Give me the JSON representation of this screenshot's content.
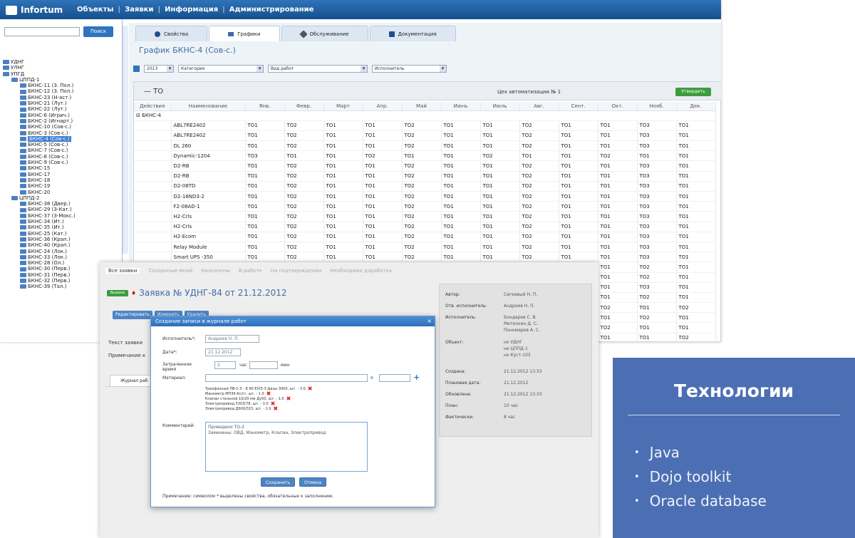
{
  "app": {
    "logo": "Infortum",
    "menu": [
      "Объекты",
      "Заявки",
      "Информация",
      "Администрирование"
    ]
  },
  "sidebar": {
    "search_button": "Поиск",
    "tree": [
      {
        "label": "УДНГ",
        "level": 0
      },
      {
        "label": "УЛНГ",
        "level": 0
      },
      {
        "label": "УПГД",
        "level": 0
      },
      {
        "label": "ЦППД-1",
        "level": 1
      },
      {
        "label": "БКНС-11 (З. Пол.)",
        "level": 2
      },
      {
        "label": "БКНС-12 (З. Пол.)",
        "level": 2
      },
      {
        "label": "БКНС-23 (Н-аст.)",
        "level": 2
      },
      {
        "label": "БКНС-21 (Лут.)",
        "level": 2
      },
      {
        "label": "БКНС-22 (Лут.)",
        "level": 2
      },
      {
        "label": "БКНС-6 (Игрич.)",
        "level": 2
      },
      {
        "label": "БКНС-2 (Игнарт.)",
        "level": 2
      },
      {
        "label": "БКНС-10 (Сов-с.)",
        "level": 2
      },
      {
        "label": "БКНС-3 (Сов-с.)",
        "level": 2
      },
      {
        "label": "БКНС-4 (Сов-с.)",
        "level": 2,
        "selected": true
      },
      {
        "label": "БКНС-5 (Сов-с.)",
        "level": 2
      },
      {
        "label": "БКНС-7 (Сов-с.)",
        "level": 2
      },
      {
        "label": "БКНС-8 (Сов-с.)",
        "level": 2
      },
      {
        "label": "БКНС-9 (Сов-с.)",
        "level": 2
      },
      {
        "label": "БКНС-15",
        "level": 2
      },
      {
        "label": "БКНС-17",
        "level": 2
      },
      {
        "label": "БКНС-18",
        "level": 2
      },
      {
        "label": "БКНС-19",
        "level": 2
      },
      {
        "label": "БКНС-20",
        "level": 2
      },
      {
        "label": "ЦППД-2",
        "level": 1
      },
      {
        "label": "БКНС-38 (Двер.)",
        "level": 2
      },
      {
        "label": "БКНС-29 (З-Кат.)",
        "level": 2
      },
      {
        "label": "БКНС-37 (З-Мокс.)",
        "level": 2
      },
      {
        "label": "БКНС-34 (Ит.)",
        "level": 2
      },
      {
        "label": "БКНС-35 (Ит.)",
        "level": 2
      },
      {
        "label": "БКНС-25 (Кат.)",
        "level": 2
      },
      {
        "label": "БКНС-36 (Крап.)",
        "level": 2
      },
      {
        "label": "БКНС-40 (Крап.)",
        "level": 2
      },
      {
        "label": "БКНС-24 (Лок.)",
        "level": 2
      },
      {
        "label": "БКНС-33 (Лок.)",
        "level": 2
      },
      {
        "label": "БКНС-28 (Ол.)",
        "level": 2
      },
      {
        "label": "БКНС-30 (Перв.)",
        "level": 2
      },
      {
        "label": "БКНС-31 (Перв.)",
        "level": 2
      },
      {
        "label": "БКНС-32 (Перв.)",
        "level": 2
      },
      {
        "label": "БКНС-39 (Тал.)",
        "level": 2
      }
    ]
  },
  "tabs": [
    "Свойства",
    "Графики",
    "Обслуживание",
    "Документация"
  ],
  "page_title": "График БКНС-4 (Сов-с.)",
  "filters": {
    "year": "2013",
    "category": "Категория",
    "work_type": "Вид работ",
    "executor": "Исполнитель"
  },
  "grid": {
    "section": "— ТО",
    "workshop": "Цех автоматизации № 1",
    "action_button": "Утвердить",
    "columns": [
      "Действия",
      "Наименование",
      "Янв.",
      "Февр.",
      "Март",
      "Апр.",
      "Май",
      "Июнь",
      "Июль",
      "Авг.",
      "Сент.",
      "Окт.",
      "Нояб.",
      "Дек."
    ],
    "group": "БКНС-4",
    "rows": [
      {
        "name": "ABL7RE2402",
        "m": [
          "ТО1",
          "ТО2",
          "ТО1",
          "ТО1",
          "ТО2",
          "ТО1",
          "ТО1",
          "ТО2",
          "ТО1",
          "ТО1",
          "ТО3",
          "ТО1"
        ]
      },
      {
        "name": "ABL7RE2402",
        "m": [
          "ТО1",
          "ТО2",
          "ТО1",
          "ТО1",
          "ТО2",
          "ТО1",
          "ТО1",
          "ТО2",
          "ТО1",
          "ТО1",
          "ТО3",
          "ТО1"
        ]
      },
      {
        "name": "DL 260",
        "m": [
          "ТО1",
          "ТО2",
          "ТО1",
          "ТО1",
          "ТО2",
          "ТО1",
          "ТО1",
          "ТО2",
          "ТО1",
          "ТО1",
          "ТО3",
          "ТО1"
        ]
      },
      {
        "name": "Dynamic-1204",
        "m": [
          "ТО3",
          "ТО1",
          "ТО1",
          "ТО2",
          "ТО1",
          "ТО1",
          "ТО2",
          "ТО1",
          "ТО1",
          "ТО2",
          "ТО1",
          "ТО1"
        ]
      },
      {
        "name": "D2-RB",
        "m": [
          "ТО1",
          "ТО2",
          "ТО1",
          "ТО1",
          "ТО2",
          "ТО1",
          "ТО1",
          "ТО2",
          "ТО1",
          "ТО1",
          "ТО3",
          "ТО1"
        ]
      },
      {
        "name": "D2-RB",
        "m": [
          "ТО1",
          "ТО2",
          "ТО1",
          "ТО1",
          "ТО2",
          "ТО1",
          "ТО1",
          "ТО2",
          "ТО1",
          "ТО1",
          "ТО3",
          "ТО1"
        ]
      },
      {
        "name": "D2-08TD",
        "m": [
          "ТО1",
          "ТО2",
          "ТО1",
          "ТО1",
          "ТО2",
          "ТО1",
          "ТО1",
          "ТО2",
          "ТО1",
          "ТО1",
          "ТО3",
          "ТО1"
        ]
      },
      {
        "name": "D2-16ND3-2",
        "m": [
          "ТО1",
          "ТО2",
          "ТО1",
          "ТО1",
          "ТО2",
          "ТО1",
          "ТО1",
          "ТО2",
          "ТО1",
          "ТО1",
          "ТО3",
          "ТО1"
        ]
      },
      {
        "name": "F2-08AD-1",
        "m": [
          "ТО1",
          "ТО2",
          "ТО1",
          "ТО1",
          "ТО2",
          "ТО1",
          "ТО1",
          "ТО2",
          "ТО1",
          "ТО1",
          "ТО3",
          "ТО1"
        ]
      },
      {
        "name": "H2-Crls",
        "m": [
          "ТО1",
          "ТО2",
          "ТО1",
          "ТО1",
          "ТО2",
          "ТО1",
          "ТО1",
          "ТО2",
          "ТО1",
          "ТО1",
          "ТО3",
          "ТО1"
        ]
      },
      {
        "name": "H2-Crls",
        "m": [
          "ТО1",
          "ТО2",
          "ТО1",
          "ТО1",
          "ТО2",
          "ТО1",
          "ТО1",
          "ТО2",
          "ТО1",
          "ТО1",
          "ТО3",
          "ТО1"
        ]
      },
      {
        "name": "H2-Ecom",
        "m": [
          "ТО1",
          "ТО2",
          "ТО1",
          "ТО1",
          "ТО2",
          "ТО1",
          "ТО1",
          "ТО2",
          "ТО1",
          "ТО1",
          "ТО3",
          "ТО1"
        ]
      },
      {
        "name": "Relay Module",
        "m": [
          "ТО1",
          "ТО2",
          "ТО1",
          "ТО1",
          "ТО2",
          "ТО1",
          "ТО1",
          "ТО2",
          "ТО1",
          "ТО1",
          "ТО3",
          "ТО1"
        ]
      },
      {
        "name": "Smart UPS -350",
        "m": [
          "ТО1",
          "ТО2",
          "ТО1",
          "ТО1",
          "ТО2",
          "ТО1",
          "ТО1",
          "ТО2",
          "ТО1",
          "ТО1",
          "ТО3",
          "ТО1"
        ]
      }
    ],
    "overflow_rows": [
      [
        "ТО1",
        "ТО2",
        "ТО1"
      ],
      [
        "ТО1",
        "ТО2",
        "ТО1"
      ],
      [
        "ТО1",
        "ТО3",
        "ТО1"
      ],
      [
        "ТО1",
        "ТО2",
        "ТО1"
      ],
      [
        "ТО2",
        "ТО1",
        "ТО2"
      ],
      [
        "ТО1",
        "ТО2",
        "ТО1"
      ],
      [
        "ТО2",
        "ТО1",
        "ТО1"
      ],
      [
        "ТО1",
        "ТО1",
        "ТО2"
      ],
      [
        "ТО1",
        "ТО2",
        "ТО1"
      ],
      [
        "ТО2",
        "ТО1",
        "ТО1"
      ]
    ]
  },
  "request": {
    "subtabs": [
      "Все заявки",
      "Созданные мной",
      "Назначены",
      "В работе",
      "На подтверждении",
      "Необходима доработка"
    ],
    "badge": "Выдана",
    "title": "Заявка № УДНГ-84 от 21.12.2012",
    "buttons": [
      "Редактировать",
      "Изменить",
      "Удалить"
    ],
    "text_label": "Текст заявки",
    "note_label": "Примечание к",
    "journal_tab": "Журнал раб",
    "info": [
      {
        "k": "Автор:",
        "v": "Сегеевый Н. П."
      },
      {
        "k": "Отв. исполнитель:",
        "v": "Андреев Н. П."
      },
      {
        "k": "Исполнитель:",
        "v": "Бондарев С. В."
      },
      {
        "k": "",
        "v": "Метелкин Д. С."
      },
      {
        "k": "",
        "v": "Пономарев А. С."
      },
      {
        "k": "Объект:",
        "v": "но УДНГ"
      },
      {
        "k": "",
        "v": "но ЦППД-1"
      },
      {
        "k": "",
        "v": "но Куст-103"
      },
      {
        "k": "Создана:",
        "v": "21.12.2012 13:33"
      },
      {
        "k": "Плановая дата:",
        "v": "21.12.2012"
      },
      {
        "k": "Обновлена:",
        "v": "21.12.2012 13:33"
      },
      {
        "k": "План:",
        "v": "10 час"
      },
      {
        "k": "Фактически:",
        "v": "8 час"
      }
    ]
  },
  "dialog": {
    "title": "Создание записи в журнале работ",
    "close": "×",
    "executor_label": "Исполнитель*:",
    "executor_value": "Андреев Н. П.",
    "date_label": "Дата*:",
    "date_value": "21.12.2012",
    "time_label": "Затраченное время",
    "hours_value": "2",
    "hours_unit": "час",
    "minutes_unit": "мин",
    "material_label": "Материал:",
    "materials": [
      "Трехфазный ПВ-1-3 - Б 80 EIX3-3 фазы 3000, шт. - 3.0",
      "Манометр МП36 бс/ст, шт. - 1.0",
      "Клапан стальной 10/20 мм Ду50, шт. - 1.0",
      "Электропривод 5303/78, шт. - 3.0",
      "Электропривод Д600/315, шт. - 1.0"
    ],
    "comment_label": "Комментарий:",
    "comment_lines": [
      "Проведено ТО-2",
      "Заменены: ОВД, Манометр, Клапан, Электропривод"
    ],
    "save_button": "Сохранить",
    "cancel_button": "Отмена",
    "footnote": "Примечание: символом * выделены свойства, обязательные к заполнению."
  },
  "tech": {
    "title": "Технологии",
    "items": [
      "Java",
      "Dojo toolkit",
      "Oracle database"
    ]
  }
}
